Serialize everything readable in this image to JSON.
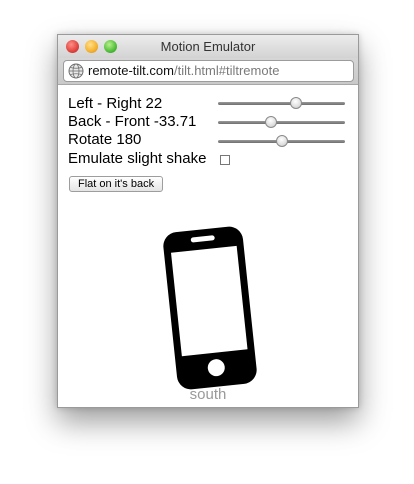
{
  "window": {
    "title": "Motion Emulator"
  },
  "url": {
    "host": "remote-tilt.com",
    "path": "/tilt.html#tiltremote"
  },
  "controls": {
    "left_right": {
      "label": "Left - Right 22",
      "value": 22,
      "min": -90,
      "max": 90
    },
    "back_front": {
      "label": "Back - Front -33.71",
      "value": -33.71,
      "min": -180,
      "max": 180
    },
    "rotate": {
      "label": "Rotate 180",
      "value": 180,
      "min": 0,
      "max": 360
    },
    "shake": {
      "label": "Emulate slight shake",
      "checked": false
    },
    "flat_button": "Flat on it's back"
  },
  "device": {
    "icon": "phone-icon",
    "orientation_label": "south"
  },
  "colors": {
    "phone": "#000000",
    "caption": "#9a9a9a"
  }
}
